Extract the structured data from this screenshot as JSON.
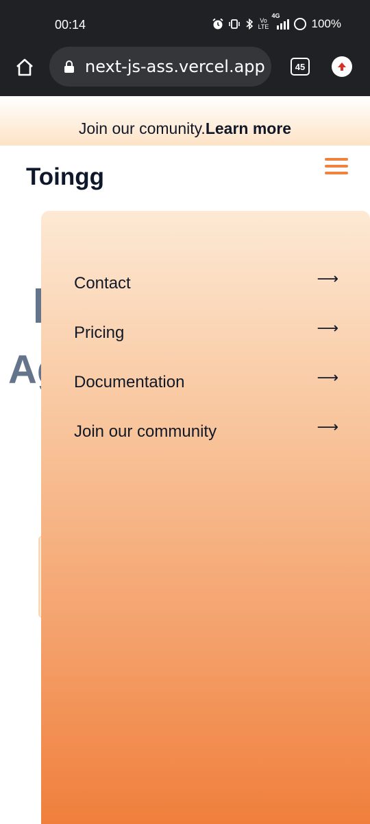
{
  "status_bar": {
    "time": "00:14",
    "battery": "100%",
    "tabs_count": "45",
    "indicators": [
      "alarm-icon",
      "vibrate-icon",
      "bluetooth-icon",
      "volte-icon",
      "signal-4g-icon",
      "ring-icon"
    ],
    "volte_label": "Vo LTE",
    "network_label": "4G"
  },
  "browser": {
    "url": "next-js-ass.vercel.app"
  },
  "banner": {
    "text": "Join our comunity.",
    "link": "Learn more"
  },
  "header": {
    "logo": "Toingg"
  },
  "background": {
    "partial_text": "Ag"
  },
  "menu": {
    "items": [
      {
        "label": "Contact",
        "arrow": "⟶"
      },
      {
        "label": "Pricing",
        "arrow": "⟶"
      },
      {
        "label": "Documentation",
        "arrow": "⟶"
      },
      {
        "label": "Join our community",
        "arrow": "⟶"
      }
    ]
  },
  "colors": {
    "accent": "#f0823e",
    "status_bar": "#202124",
    "panel_top": "#fde9d4",
    "panel_bottom": "#f07f3c"
  }
}
